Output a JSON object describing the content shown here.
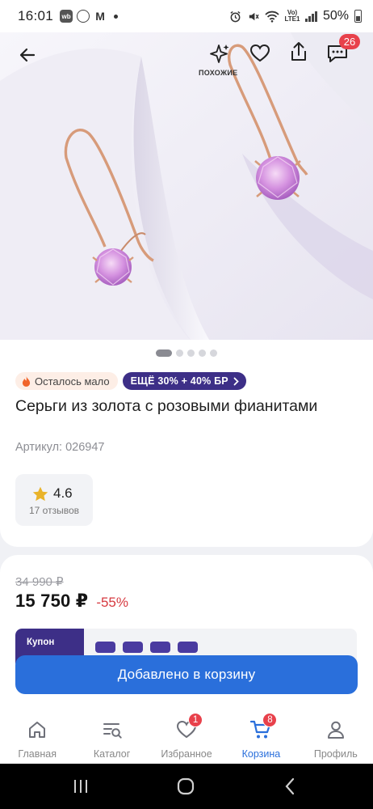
{
  "status_bar": {
    "time": "16:01",
    "app_icons": [
      "wb-icon",
      "whatsapp-icon",
      "gmail-icon"
    ],
    "battery": "50%"
  },
  "top_actions": {
    "similar_label": "ПОХОЖИЕ",
    "chat_badge": "26"
  },
  "gallery": {
    "image_count": 5,
    "active_index": 0
  },
  "product": {
    "stock_badge": "Осталось мало",
    "promo_badge": "ЕЩЁ 30% + 40% БР",
    "title": "Серьги из золота с розовыми фианитами",
    "sku": "Артикул: 026947",
    "rating": "4.6",
    "reviews": "17 отзывов"
  },
  "price": {
    "old_price": "34 990 ₽",
    "current_price": "15 750 ₽",
    "discount": "-55%",
    "coupon_label": "Купон"
  },
  "cta": {
    "label": "Добавлено в корзину"
  },
  "bottom_nav": {
    "items": [
      {
        "label": "Главная",
        "icon": "home-icon"
      },
      {
        "label": "Каталог",
        "icon": "catalog-search-icon"
      },
      {
        "label": "Избранное",
        "icon": "heart-icon",
        "badge": "1"
      },
      {
        "label": "Корзина",
        "icon": "cart-icon",
        "badge": "8",
        "active": true
      },
      {
        "label": "Профиль",
        "icon": "profile-icon"
      }
    ]
  },
  "colors": {
    "accent_blue": "#2a6fdb",
    "promo_purple": "#3d2f87",
    "discount_red": "#d6393f",
    "badge_red": "#e8414b"
  }
}
